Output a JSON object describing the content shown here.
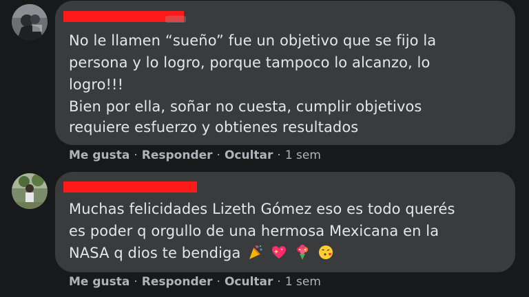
{
  "comments": [
    {
      "avatar_icon": "profile-photo-icon",
      "lines": [
        "No le llamen “sueño” fue un objetivo que se fijo la",
        "persona y lo logro, porque tampoco lo alcanzo, lo",
        "logro!!!",
        "Bien por ella, soñar no cuesta, cumplir objetivos",
        "requiere esfuerzo y obtienes resultados"
      ],
      "actions": {
        "like": "Me gusta",
        "reply": "Responder",
        "hide": "Ocultar",
        "time": "1 sem"
      }
    },
    {
      "avatar_icon": "profile-photo-icon",
      "lines": [
        "Muchas felicidades Lizeth Gómez eso es todo querés",
        "es poder q orgullo de una hermosa Mexicana en la",
        "NASA q dios te bendiga"
      ],
      "emojis": [
        "party-popper-icon",
        "sparkling-heart-icon",
        "bouquet-icon",
        "face-blowing-kiss-icon"
      ],
      "actions": {
        "like": "Me gusta",
        "reply": "Responder",
        "hide": "Ocultar",
        "time": "1 sem"
      }
    }
  ],
  "colors": {
    "background": "#18191a",
    "bubble": "#3a3b3c",
    "text": "#e4e6eb",
    "secondary_text": "#b0b3b8",
    "redaction": "#ff1a1a"
  }
}
